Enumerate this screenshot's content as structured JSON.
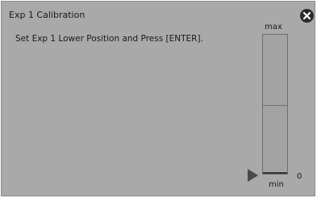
{
  "dialog": {
    "title": "Exp 1 Calibration",
    "instruction": "Set Exp 1 Lower Position and Press [ENTER].",
    "close_icon": "close-circle-icon"
  },
  "gauge": {
    "max_label": "max",
    "min_label": "min",
    "value": "0",
    "level_fraction": 0.0,
    "pointer_icon": "triangle-right-icon"
  },
  "colors": {
    "panel_background": "#a9a9a9",
    "gauge_fill": "#a3a3a3",
    "pointer": "#4a4a4a",
    "close_button": "#2a2a2a"
  }
}
